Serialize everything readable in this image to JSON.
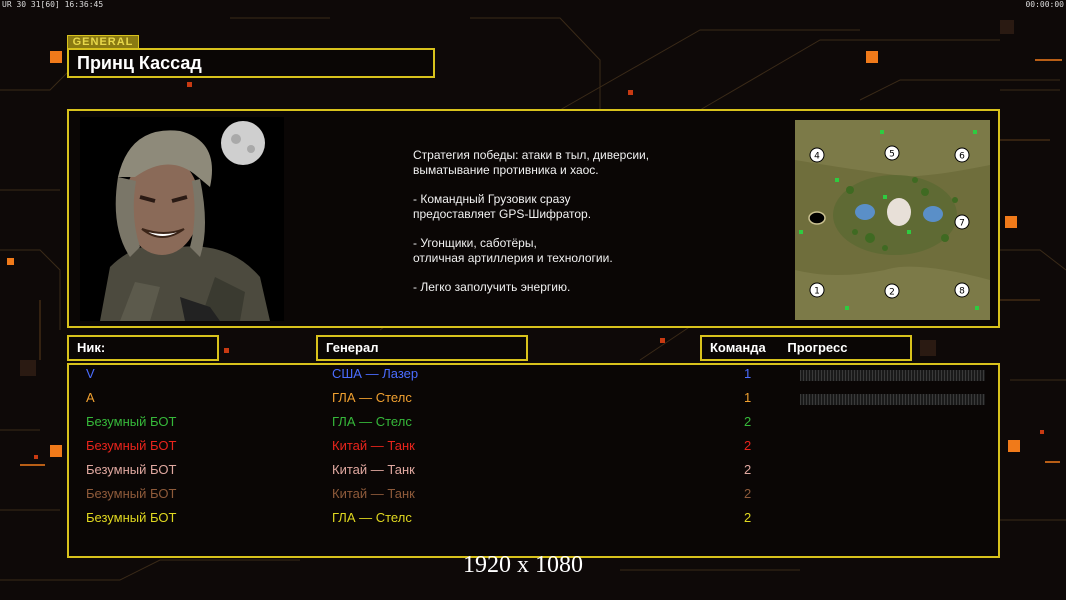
{
  "debug": {
    "left": "UR 30 31[60] 16:36:45",
    "right": "00:00:00"
  },
  "header": {
    "tag": "GENERAL",
    "general_name": "Принц Кассад"
  },
  "description": [
    "Стратегия победы: атаки в тыл, диверсии,\n выматывание противника и хаос.",
    "- Командный Грузовик сразу\nпредоставляет GPS-Шифратор.",
    "- Угонщики, саботёры,\nотличная артиллерия и технологии.",
    "- Легко заполучить энергию."
  ],
  "minimap": {
    "slots": [
      "4",
      "5",
      "6",
      "7",
      "1",
      "2",
      "8"
    ]
  },
  "columns": {
    "nick": "Ник:",
    "general": "Генерал",
    "team": "Команда",
    "progress": "Прогресс"
  },
  "players": [
    {
      "nick": "V",
      "general": "США — Лазер",
      "team": "1",
      "color": "#4a6cff",
      "progress": 0
    },
    {
      "nick": "A",
      "general": "ГЛА — Стелс",
      "team": "1",
      "color": "#f0a030",
      "progress": 0
    },
    {
      "nick": "Безумный БОТ",
      "general": "ГЛА — Стелс",
      "team": "2",
      "color": "#36b83a",
      "progress": null
    },
    {
      "nick": "Безумный БОТ",
      "general": "Китай — Танк",
      "team": "2",
      "color": "#e8241c",
      "progress": null
    },
    {
      "nick": "Безумный БОТ",
      "general": "Китай — Танк",
      "team": "2",
      "color": "#e0a8a0",
      "progress": null
    },
    {
      "nick": "Безумный БОТ",
      "general": "Китай — Танк",
      "team": "2",
      "color": "#8e5a3a",
      "progress": null
    },
    {
      "nick": "Безумный БОТ",
      "general": "ГЛА — Стелс",
      "team": "2",
      "color": "#e0d820",
      "progress": null
    }
  ],
  "overlay_resolution": "1920 x 1080",
  "colors": {
    "frame": "#d8c21c",
    "accent_orange": "#f07a1a",
    "background": "#0e0908"
  }
}
